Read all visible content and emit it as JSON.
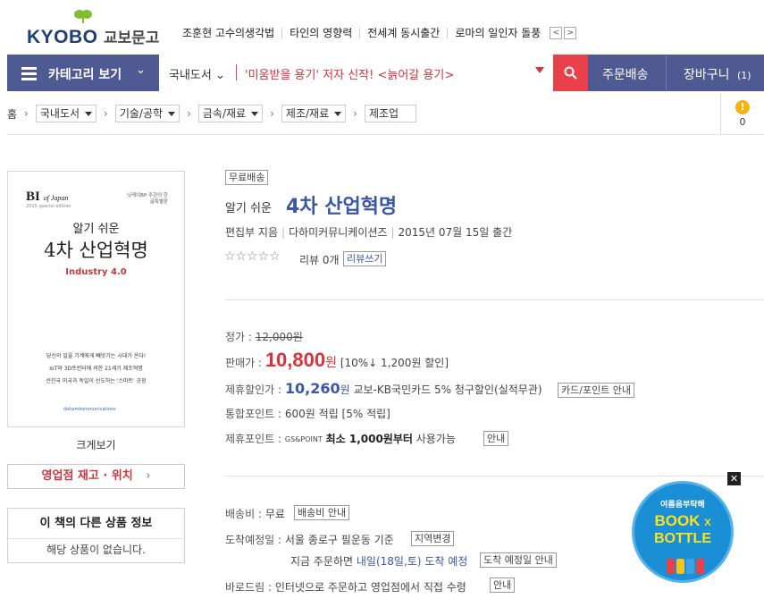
{
  "header": {
    "logo_text": "KYOBO",
    "logo_kr": "교보문고",
    "trending": [
      "조훈현 고수의생각법",
      "타인의 영향력",
      "전세계 동시출간",
      "로마의 일인자 돌풍"
    ],
    "prev_arrow": "<",
    "next_arrow": ">"
  },
  "nav": {
    "category_label": "카테고리 보기",
    "search_scope": "국내도서",
    "search_query": "'미움받을 용기' 저자 신작! <늙어갈 용기>",
    "order_delivery": "주문배송",
    "cart_label": "장바구니",
    "cart_count": "(1)"
  },
  "breadcrumb": {
    "home": "홈",
    "levels": [
      "국내도서",
      "기술/공학",
      "금속/재료",
      "제조/재료",
      "제조업"
    ]
  },
  "quick_cart": {
    "count": "0"
  },
  "cover": {
    "series": "BI",
    "series_of": "of Japan",
    "series_edition": "2015 special edition",
    "publisher_top": "닛케이BP 주관의 한글특별판",
    "title_small": "알기 쉬운",
    "title_large": "4차 산업혁명",
    "subtitle": "Industry 4.0",
    "copy1": "당신의 일을 기계에게 빼앗기는 시대가 온다!",
    "copy2": "IoT와 3D프린터에 의한 21세기 제조혁명",
    "copy3": "선진국 미국과 독일이 선도하는 '스마트' 공장",
    "publisher_logo": "dahamkommunications"
  },
  "left": {
    "enlarge": "크게보기",
    "stock_label": "영업점 재고 · 위치",
    "stock_arrow": "›",
    "other_title": "이 책의 다른 상품 정보",
    "other_empty": "해당 상품이 없습니다."
  },
  "product": {
    "badge": "무료배송",
    "subtitle": "알기 쉬운",
    "title": "4차 산업혁명",
    "author": "편집부 지음",
    "publisher": "다하미커뮤니케이션즈",
    "date": "2015년 07월 15일 출간",
    "stars": "☆☆☆☆☆",
    "review_label": "리뷰 0개",
    "review_button": "리뷰쓰기"
  },
  "pricing": {
    "list_label": "정가 :",
    "list_price": "12,000원",
    "sale_label": "판매가 :",
    "sale_price": "10,800",
    "won": "원",
    "discount": "[10%↓ 1,200원 할인]",
    "partner_label": "제휴할인가 :",
    "partner_price": "10,260",
    "partner_won": "원",
    "partner_note": "교보-KB국민카드 5% 청구할인(실적무관)",
    "partner_btn": "카드/포인트 안내",
    "points_label": "통합포인트 :",
    "points_value": "600원 적립 [5% 적립]",
    "gs_label": "제휴포인트 :",
    "gs_brand": "GS&POINT",
    "gs_note_bold": "최소 1,000원부터",
    "gs_note": "사용가능",
    "gs_btn": "안내"
  },
  "shipping": {
    "fee_label": "배송비 :",
    "fee_value": "무료",
    "fee_btn": "배송비 안내",
    "eta_label": "도착예정일 :",
    "eta_value": "서울 종로구 필운동 기준",
    "eta_btn": "지역변경",
    "eta_line2a": "지금 주문하면",
    "eta_line2b": "내일(18일,토) 도착 예정",
    "eta_btn2": "도착 예정일 안내",
    "barodrim_label": "바로드림 :",
    "barodrim_value": "인터넷으로 주문하고 영업점에서 직접 수령",
    "barodrim_btn": "안내"
  },
  "promo": {
    "line1": "여름음부탁해",
    "line2": "BOOK",
    "line2b": "X",
    "line3": "BOTTLE",
    "close": "✕"
  }
}
